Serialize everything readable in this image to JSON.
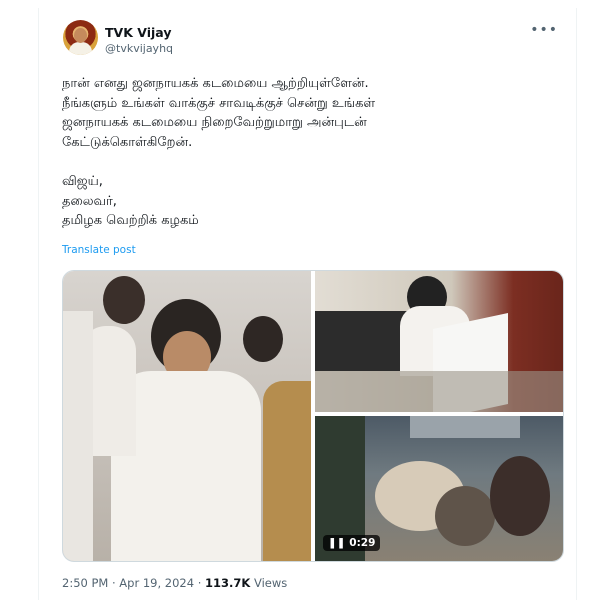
{
  "author": {
    "name": "TVK Vijay",
    "handle": "@tvkvijayhq"
  },
  "more_icon": "more-horizontal-icon",
  "post": {
    "lines": [
      "நான் எனது ஜனநாயகக் கடமையை ஆற்றியுள்ளேன்.",
      "நீங்களும் உங்கள் வாக்குச் சாவடிக்குச் சென்று உங்கள்",
      "ஜனநாயகக் கடமையை நிறைவேற்றுமாறு அன்புடன்",
      "கேட்டுக்கொள்கிறேன்."
    ],
    "signature": [
      "விஜய்,",
      "தலைவர்,",
      "தமிழக வெற்றிக் கழகம்"
    ],
    "translate_label": "Translate post"
  },
  "media": {
    "video_duration": "0:29",
    "pause_icon": "pause-icon"
  },
  "meta": {
    "timestamp": "2:50 PM · Apr 19, 2024",
    "separator": "·",
    "views_count": "113.7K",
    "views_label": "Views"
  }
}
